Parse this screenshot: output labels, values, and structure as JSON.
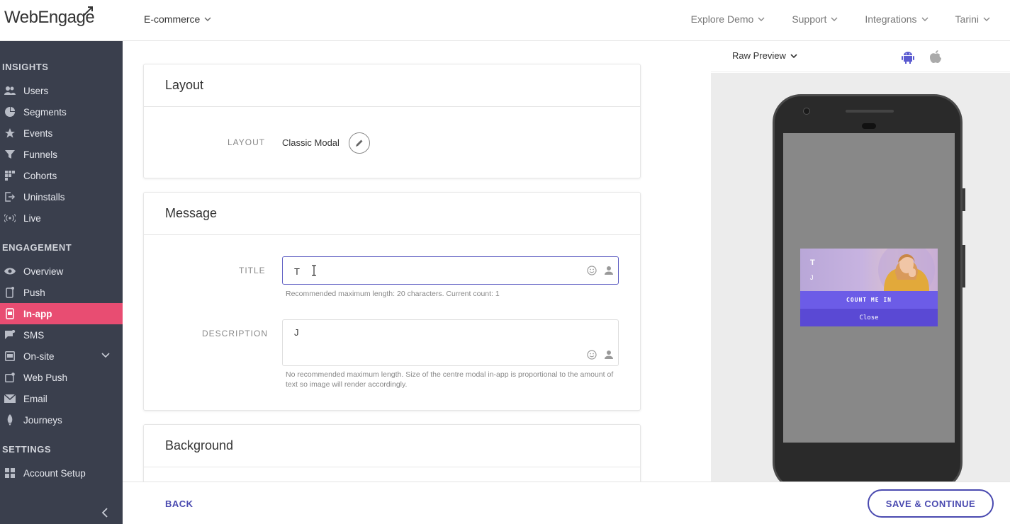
{
  "header": {
    "logo": "WebEngage",
    "project": "E-commerce",
    "nav": [
      "Explore Demo",
      "Support",
      "Integrations",
      "Tarini"
    ]
  },
  "sidebar": {
    "insights_title": "INSIGHTS",
    "insights": [
      {
        "label": "Users",
        "icon": "users-icon"
      },
      {
        "label": "Segments",
        "icon": "pie-icon"
      },
      {
        "label": "Events",
        "icon": "star-icon"
      },
      {
        "label": "Funnels",
        "icon": "funnel-icon"
      },
      {
        "label": "Cohorts",
        "icon": "grid-icon"
      },
      {
        "label": "Uninstalls",
        "icon": "exit-icon"
      },
      {
        "label": "Live",
        "icon": "broadcast-icon"
      }
    ],
    "engagement_title": "ENGAGEMENT",
    "engagement": [
      {
        "label": "Overview",
        "icon": "eye-icon"
      },
      {
        "label": "Push",
        "icon": "phone-icon"
      },
      {
        "label": "In-app",
        "icon": "inapp-icon"
      },
      {
        "label": "SMS",
        "icon": "sms-icon"
      },
      {
        "label": "On-site",
        "icon": "onsite-icon"
      },
      {
        "label": "Web Push",
        "icon": "webpush-icon"
      },
      {
        "label": "Email",
        "icon": "mail-icon"
      },
      {
        "label": "Journeys",
        "icon": "rocket-icon"
      }
    ],
    "settings_title": "SETTINGS",
    "settings": [
      {
        "label": "Account Setup",
        "icon": "grid-icon"
      }
    ]
  },
  "layout_card": {
    "title": "Layout",
    "label": "LAYOUT",
    "value": "Classic Modal"
  },
  "message_card": {
    "title": "Message",
    "title_label": "TITLE",
    "title_value": "T",
    "title_hint": "Recommended maximum length: 20 characters. Current count: 1",
    "description_label": "DESCRIPTION",
    "description_value": "J",
    "description_hint": "No recommended maximum length. Size of the centre modal in-app is proportional to the amount of text so image will render accordingly."
  },
  "background_card": {
    "title": "Background"
  },
  "preview": {
    "mode": "Raw Preview",
    "platforms": [
      "android-icon",
      "apple-icon"
    ],
    "modal_title": "T",
    "modal_description": "J",
    "cta": "COUNT ME IN",
    "close": "Close",
    "accent": "#6c5ce7"
  },
  "footer": {
    "back": "BACK",
    "save": "SAVE & CONTINUE"
  }
}
